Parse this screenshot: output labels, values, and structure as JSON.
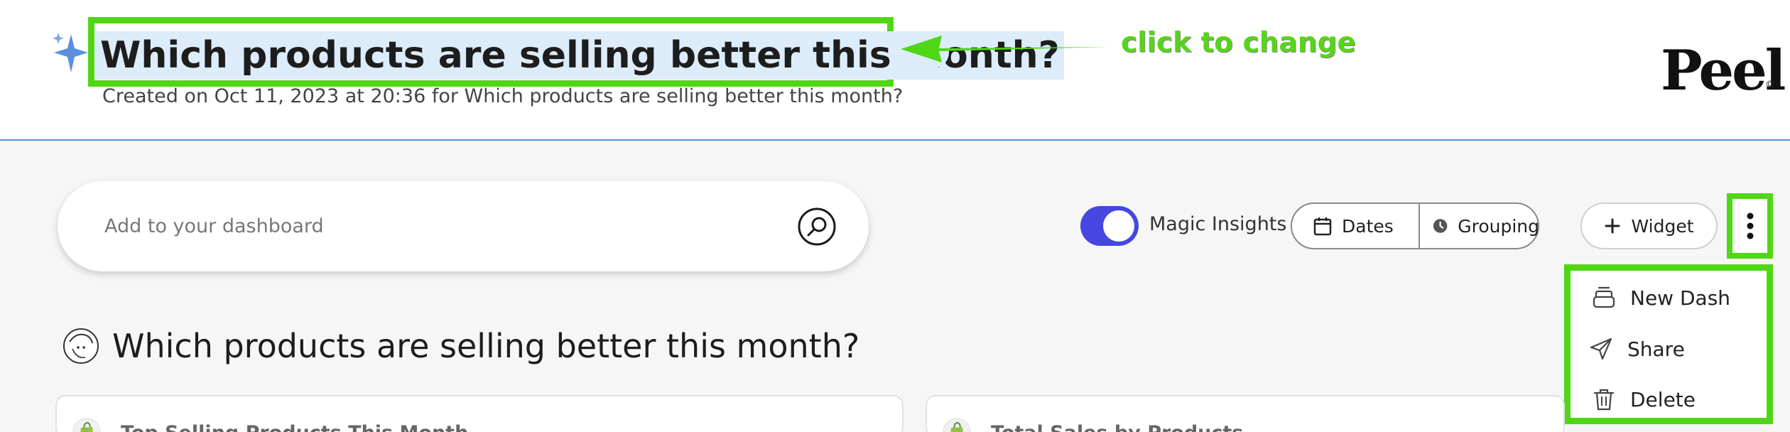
{
  "header": {
    "title": "Which products are selling better this month?",
    "subtitle": "Created on Oct 11, 2023 at 20:36 for Which products are selling better this month?",
    "annotation": "click to change",
    "logo_text": "Peel",
    "logo_mark": "©"
  },
  "search": {
    "placeholder": "Add to your dashboard"
  },
  "toolbar": {
    "magic_insights_label": "Magic Insights",
    "magic_insights_on": true,
    "dates_label": "Dates",
    "grouping_label": "Grouping",
    "widget_label": "Widget"
  },
  "menu": {
    "items": [
      {
        "label": "New Dash",
        "icon": "stack-icon"
      },
      {
        "label": "Share",
        "icon": "send-icon"
      },
      {
        "label": "Delete",
        "icon": "trash-icon"
      }
    ]
  },
  "section": {
    "title": "Which products are selling better this month?"
  },
  "cards": [
    {
      "title": "Top Selling Products This Month"
    },
    {
      "title": "Total Sales by Products"
    }
  ],
  "colors": {
    "annotation_green": "#4fd716",
    "accent": "#4646e0",
    "title_highlight": "#dcecfb",
    "header_border": "#5b8fd8"
  }
}
